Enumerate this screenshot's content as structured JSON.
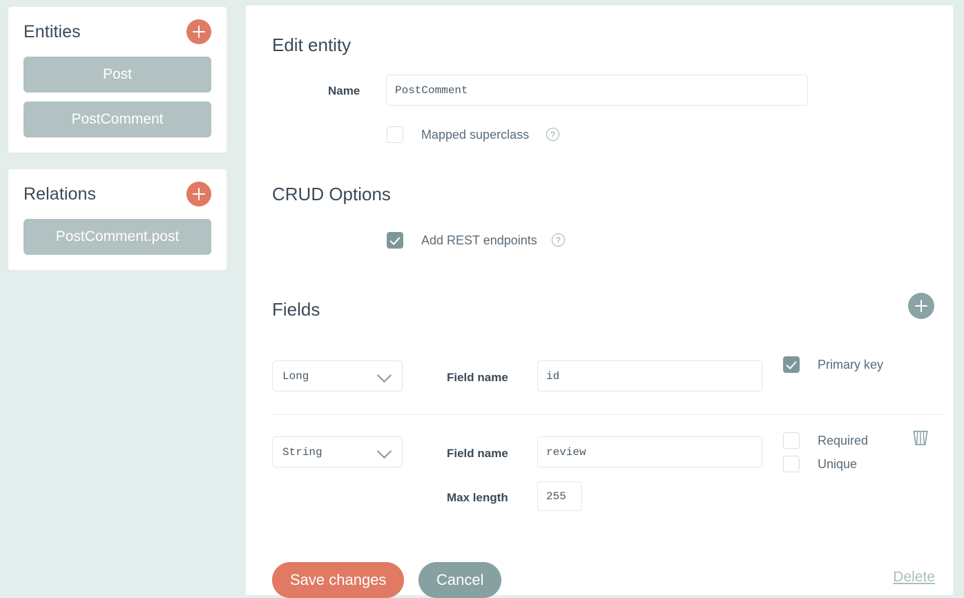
{
  "sidebar": {
    "entities_panel": {
      "title": "Entities",
      "add_label": "+",
      "items": [
        {
          "label": "Post"
        },
        {
          "label": "PostComment"
        }
      ]
    },
    "relations_panel": {
      "title": "Relations",
      "add_label": "+",
      "items": [
        {
          "label": "PostComment.post"
        }
      ]
    }
  },
  "main": {
    "edit_entity": {
      "title": "Edit entity",
      "name_label": "Name",
      "name_value": "PostComment",
      "mapped_superclass_label": "Mapped superclass",
      "mapped_superclass_checked": false,
      "help_glyph": "?"
    },
    "crud": {
      "title": "CRUD Options",
      "rest_label": "Add REST endpoints",
      "rest_checked": true,
      "help_glyph": "?"
    },
    "fields": {
      "title": "Fields",
      "add_label": "+",
      "field_name_label": "Field name",
      "max_length_label": "Max length",
      "rows": [
        {
          "type": "Long",
          "name": "id",
          "checkbox_primary_label": "Primary key",
          "primary_checked": true
        },
        {
          "type": "String",
          "name": "review",
          "max_length": "255",
          "required_label": "Required",
          "required_checked": false,
          "unique_label": "Unique",
          "unique_checked": false,
          "delete_icon": "trash-icon"
        }
      ]
    },
    "footer": {
      "save_label": "Save changes",
      "cancel_label": "Cancel",
      "delete_label": "Delete"
    }
  },
  "colors": {
    "background": "#e3eeec",
    "accent": "#e07a63",
    "muted": "#b2c1c1",
    "checkbox_checked": "#7e9798",
    "heading": "#3b4a57"
  }
}
